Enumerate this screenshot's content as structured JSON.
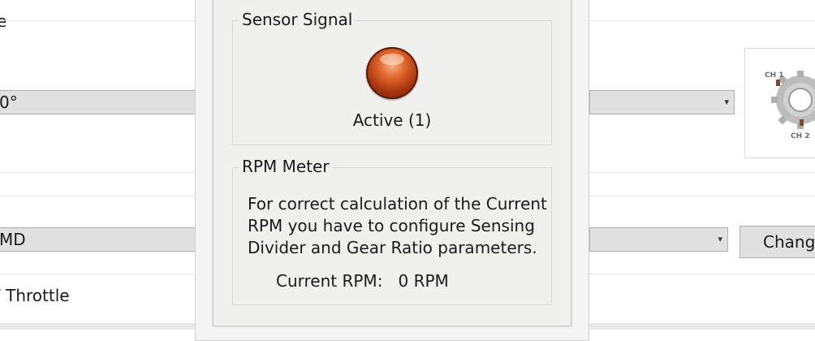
{
  "background": {
    "labels": [
      "e",
      "0°",
      "MD",
      "/ Throttle"
    ],
    "combo_left_values": [
      "0°",
      "MD"
    ],
    "change_button": "Chang",
    "diagram": {
      "ch1_label": "CH 1",
      "ch2_label": "CH 2"
    }
  },
  "dialog": {
    "sensor_signal": {
      "title": "Sensor Signal",
      "status": "Active (1)"
    },
    "rpm_meter": {
      "title": "RPM Meter",
      "description_lines": [
        "For correct calculation of the Current",
        "RPM you have to configure Sensing",
        "Divider and Gear Ratio parameters."
      ],
      "current_label": "Current RPM:",
      "current_value": "0 RPM"
    }
  },
  "colors": {
    "led": "#c2451a",
    "panel": "#f0f0ef"
  }
}
